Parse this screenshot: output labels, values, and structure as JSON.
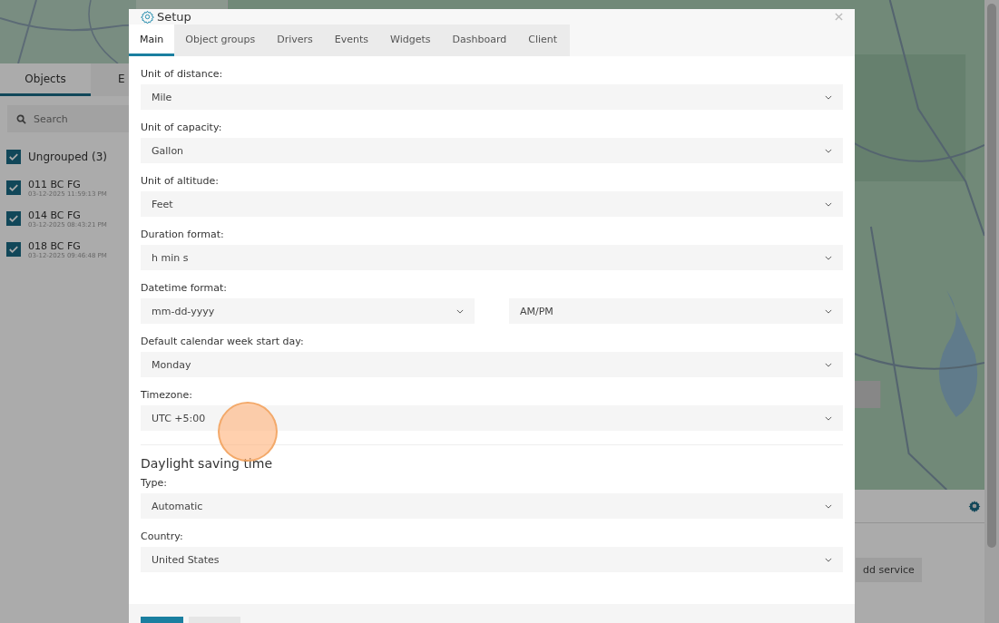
{
  "sidebar": {
    "tabs": [
      {
        "label": "Objects",
        "selected": true
      },
      {
        "label": "E",
        "selected": false
      }
    ],
    "search": {
      "placeholder": "Search"
    },
    "group": {
      "label": "Ungrouped (3)",
      "checked": true
    },
    "objects": [
      {
        "name": "011 BC FG",
        "time": "03-12-2025 11:59:13 PM",
        "checked": true
      },
      {
        "name": "014 BC FG",
        "time": "03-12-2025 08:43:21 PM",
        "checked": true
      },
      {
        "name": "018 BC FG",
        "time": "03-12-2025 09:46:48 PM",
        "checked": true
      }
    ]
  },
  "bottom_panel": {
    "button": "dd service"
  },
  "dialog": {
    "title": "Setup",
    "tabs": [
      {
        "label": "Main",
        "selected": true
      },
      {
        "label": "Object groups",
        "selected": false
      },
      {
        "label": "Drivers",
        "selected": false
      },
      {
        "label": "Events",
        "selected": false
      },
      {
        "label": "Widgets",
        "selected": false
      },
      {
        "label": "Dashboard",
        "selected": false
      },
      {
        "label": "Client",
        "selected": false
      }
    ],
    "fields": [
      {
        "label": "Unit of distance:",
        "selects": [
          "Mile"
        ]
      },
      {
        "label": "Unit of capacity:",
        "selects": [
          "Gallon"
        ]
      },
      {
        "label": "Unit of altitude:",
        "selects": [
          "Feet"
        ]
      },
      {
        "label": "Duration format:",
        "selects": [
          "h min s"
        ]
      },
      {
        "label": "Datetime format:",
        "selects": [
          "mm-dd-yyyy",
          "AM/PM"
        ]
      },
      {
        "label": "Default calendar week start day:",
        "selects": [
          "Monday"
        ]
      },
      {
        "label": "Timezone:",
        "selects": [
          "UTC +5:00"
        ]
      }
    ],
    "section_title": "Daylight saving time",
    "dst_fields": [
      {
        "label": "Type:",
        "selects": [
          "Automatic"
        ]
      },
      {
        "label": "Country:",
        "selects": [
          "United States"
        ]
      }
    ]
  }
}
